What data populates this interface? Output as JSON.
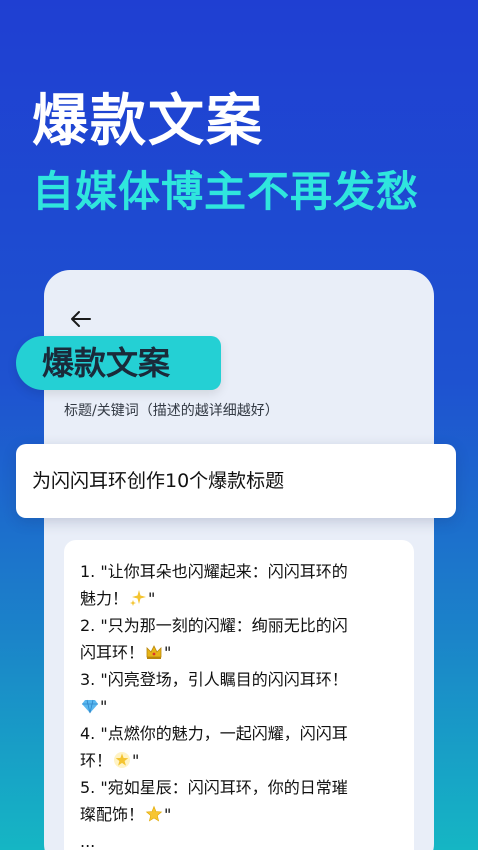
{
  "hero": {
    "title": "爆款文案",
    "subtitle": "自媒体博主不再发愁"
  },
  "screen": {
    "tag_label": "爆款文案",
    "field_label": "标题/关键词（描述的越详细越好）",
    "input_value": "为闪闪耳环创作10个爆款标题",
    "results": {
      "l1": "1. \"让你耳朵也闪耀起来：闪闪耳环的",
      "l2": "魅力！",
      "l2_end": "\"",
      "l3": "2. \"只为那一刻的闪耀：绚丽无比的闪",
      "l4": "闪耳环！",
      "l4_end": "\"",
      "l5": "3. \"闪亮登场，引人瞩目的闪闪耳环！",
      "l6_end": "\"",
      "l7": "4. \"点燃你的魅力，一起闪耀，闪闪耳",
      "l8": "环！",
      "l8_end": "\"",
      "l9": "5. \"宛如星辰：闪闪耳环，你的日常璀",
      "l10": "璨配饰！",
      "l10_end": "\"",
      "l11": "..."
    }
  },
  "icons": {
    "back": "arrow-left-icon",
    "e1": "sparkles-icon",
    "e2": "crown-icon",
    "e3": "gem-icon",
    "e4": "glowing-star-icon",
    "e5": "star-icon"
  },
  "colors": {
    "accent": "#24d0d4",
    "subtitle": "#2fe6dd"
  }
}
